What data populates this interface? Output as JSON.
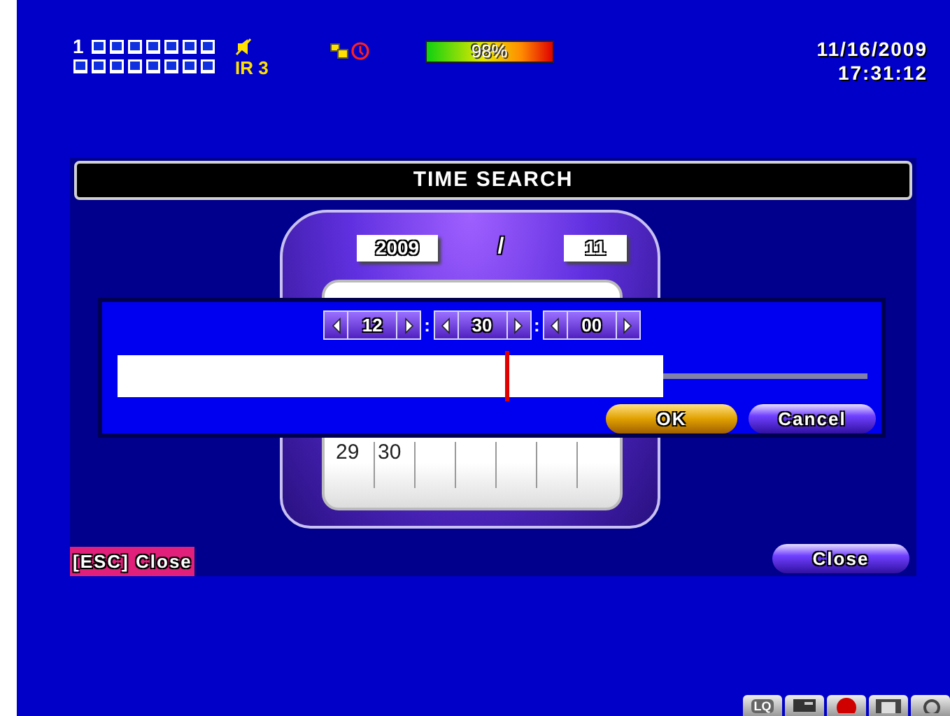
{
  "status_bar": {
    "channel_number": "1",
    "ir_label": "IR 3",
    "hdd_usage": "98%",
    "date": "11/16/2009",
    "time": "17:31:12"
  },
  "dialog": {
    "title": "TIME SEARCH",
    "year": "2009",
    "date_separator": "/",
    "month": "11",
    "calendar_cells": [
      "29",
      "30",
      "",
      "",
      "",
      "",
      ""
    ],
    "time_picker": {
      "fields": [
        {
          "value": "12"
        },
        {
          "value": "30"
        },
        {
          "value": "00"
        }
      ],
      "separators": [
        ":",
        ":"
      ],
      "timeline": {
        "level": 0.71
      },
      "buttons": [
        {
          "label": "OK",
          "kind": "primary"
        },
        {
          "label": "Cancel",
          "kind": "secondary"
        }
      ]
    },
    "hint": "[ESC] Close",
    "close_button": "Close"
  },
  "tray": {
    "quality_label": "LQ"
  }
}
